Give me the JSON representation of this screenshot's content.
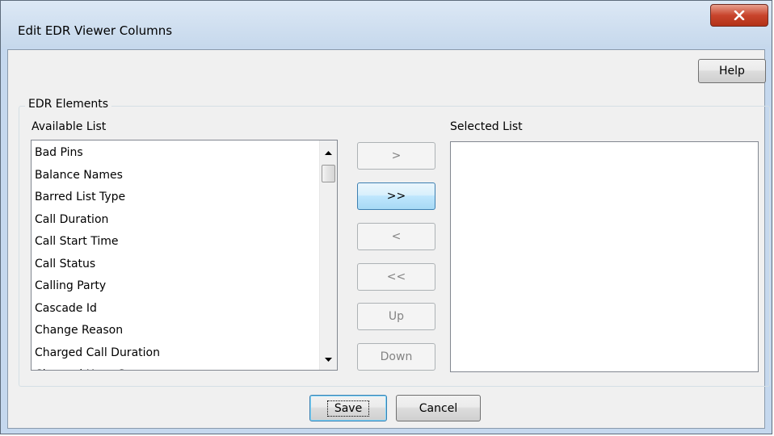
{
  "window": {
    "title": "Edit EDR Viewer Columns",
    "close_label": "X"
  },
  "toolbar": {
    "help_label": "Help"
  },
  "group": {
    "label": "EDR Elements"
  },
  "available": {
    "label": "Available List",
    "items": [
      "Bad Pins",
      "Balance Names",
      "Barred List Type",
      "Call Duration",
      "Call Start Time",
      "Call Status",
      "Calling Party",
      "Cascade Id",
      "Change Reason",
      "Charged Call Duration",
      "Charged Hour Group"
    ]
  },
  "selected": {
    "label": "Selected List",
    "items": []
  },
  "transfer": {
    "add_label": ">",
    "add_all_label": ">>",
    "remove_label": "<",
    "remove_all_label": "<<",
    "up_label": "Up",
    "down_label": "Down"
  },
  "footer": {
    "save_label": "Save",
    "cancel_label": "Cancel"
  },
  "colors": {
    "title_bar": "#c6d8ec",
    "close_button": "#c8442c",
    "dialog_background": "#f0f0f0",
    "hover_button": "#bee6fd"
  }
}
